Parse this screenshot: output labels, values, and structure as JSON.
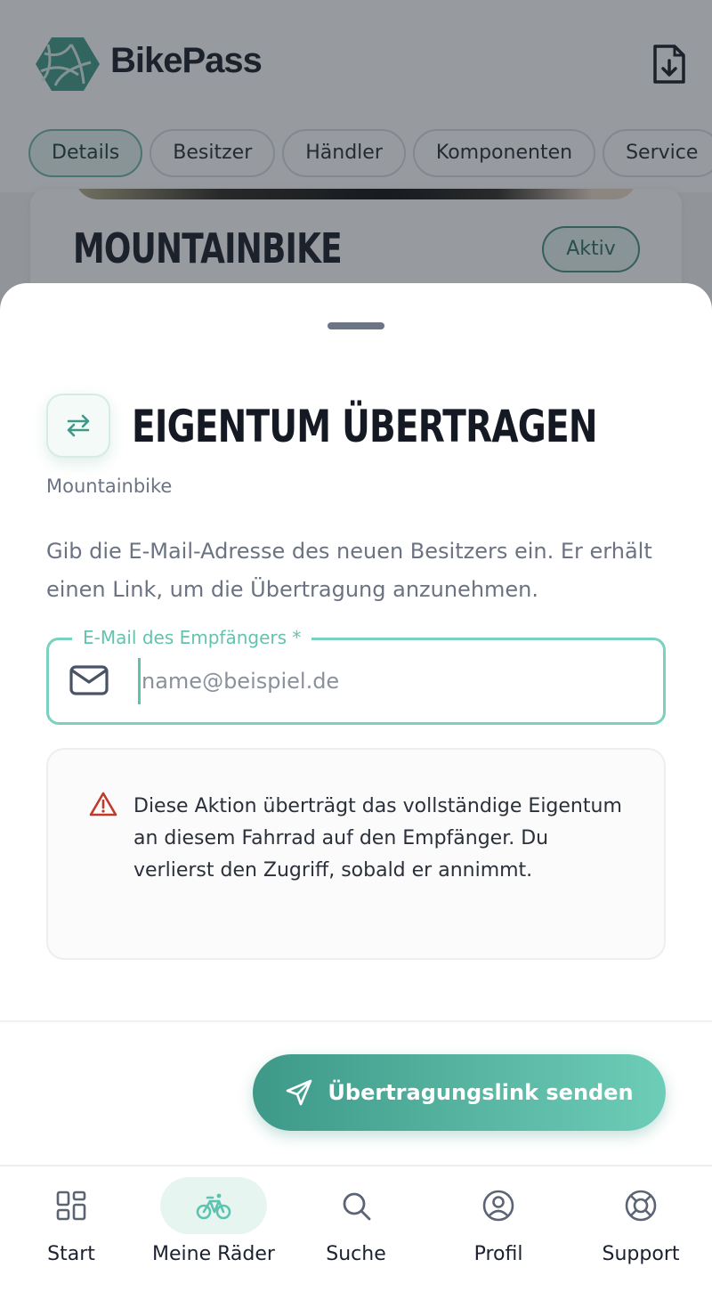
{
  "app": {
    "brand": "BikePass"
  },
  "tabs": [
    {
      "label": "Details",
      "active": true
    },
    {
      "label": "Besitzer",
      "active": false
    },
    {
      "label": "Händler",
      "active": false
    },
    {
      "label": "Komponenten",
      "active": false
    },
    {
      "label": "Service",
      "active": false
    }
  ],
  "bike_card": {
    "title": "MOUNTAINBIKE",
    "status": "Aktiv"
  },
  "sheet": {
    "title": "EIGENTUM ÜBERTRAGEN",
    "subtitle": "Mountainbike",
    "description": "Gib die E-Mail-Adresse des neuen Besitzers ein. Er erhält einen Link, um die Übertragung anzunehmen.",
    "email_field": {
      "label": "E-Mail des Empfängers *",
      "placeholder": "name@beispiel.de",
      "value": ""
    },
    "warning": "Diese Aktion überträgt das vollständige Eigentum an diesem Fahrrad auf den Empfänger. Du verlierst den Zugriff, sobald er annimmt.",
    "send_button": "Übertragungslink senden"
  },
  "nav": [
    {
      "label": "Start",
      "icon": "grid-icon",
      "active": false
    },
    {
      "label": "Meine Räder",
      "icon": "bike-icon",
      "active": true
    },
    {
      "label": "Suche",
      "icon": "search-icon",
      "active": false
    },
    {
      "label": "Profil",
      "icon": "user-icon",
      "active": false
    },
    {
      "label": "Support",
      "icon": "lifebuoy-icon",
      "active": false
    }
  ],
  "colors": {
    "accent": "#3e9988",
    "accent_light": "#7ad1bf",
    "warning": "#c0392b",
    "text_dark": "#141923",
    "text_muted": "#6b7383"
  }
}
